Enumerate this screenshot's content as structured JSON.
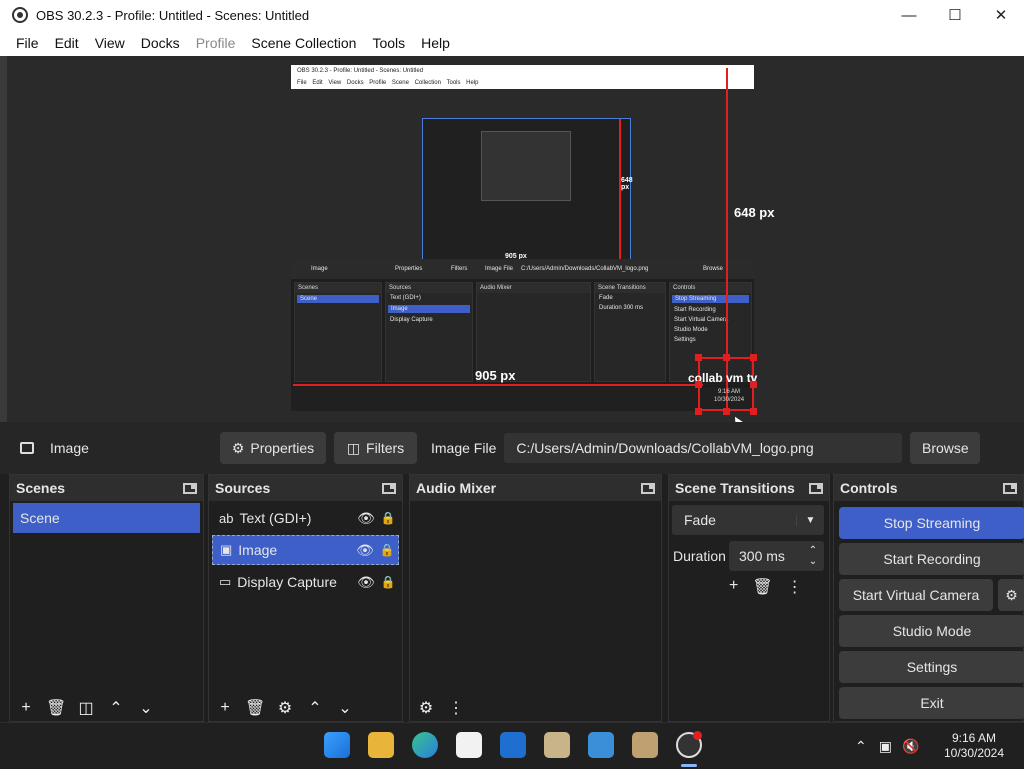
{
  "window": {
    "title": "OBS 30.2.3 - Profile: Untitled - Scenes: Untitled"
  },
  "menu": {
    "items": [
      "File",
      "Edit",
      "View",
      "Docks",
      "Profile",
      "Scene Collection",
      "Tools",
      "Help"
    ]
  },
  "preview": {
    "nested_title": "OBS 30.2.3 - Profile: Untitled - Scenes: Untitled",
    "nested_menu": "File Edit View Docks Profile Scene Collection Tools Help",
    "height_label": "648 px",
    "width_label": "905 px",
    "inner_height_label": "648 px",
    "inner_width_label": "905 px",
    "nested_source": "Image",
    "nested_properties": "Properties",
    "nested_filters": "Filters",
    "nested_image_file": "Image File",
    "nested_path": "C:/Users/Admin/Downloads/CollabVM_logo.png",
    "nested_browse": "Browse",
    "nested_scenes": "Scenes",
    "nested_scene": "Scene",
    "nested_sources": "Sources",
    "nested_src1": "Text (GDI+)",
    "nested_src2": "Image",
    "nested_src3": "Display Capture",
    "nested_mixer": "Audio Mixer",
    "nested_transitions": "Scene Transitions",
    "nested_fade": "Fade",
    "nested_duration": "Duration",
    "nested_ms": "300 ms",
    "nested_controls": "Controls",
    "nested_c1": "Stop Streaming",
    "nested_c2": "Start Recording",
    "nested_c3": "Start Virtual Camera",
    "nested_c4": "Studio Mode",
    "nested_c5": "Settings",
    "nested_logo": "collab vm tv",
    "nested_time": "9:16 AM",
    "nested_date": "10/30/2024"
  },
  "source_bar": {
    "name": "Image",
    "properties": "Properties",
    "filters": "Filters",
    "image_file_label": "Image File",
    "path": "C:/Users/Admin/Downloads/CollabVM_logo.png",
    "browse": "Browse"
  },
  "scenes": {
    "title": "Scenes",
    "items": [
      "Scene"
    ]
  },
  "sources": {
    "title": "Sources",
    "items": [
      "Text (GDI+)",
      "Image",
      "Display Capture"
    ]
  },
  "mixer": {
    "title": "Audio Mixer"
  },
  "transitions": {
    "title": "Scene Transitions",
    "type": "Fade",
    "duration_label": "Duration",
    "duration": "300 ms"
  },
  "controls": {
    "title": "Controls",
    "stop_streaming": "Stop Streaming",
    "start_recording": "Start Recording",
    "start_virtual_camera": "Start Virtual Camera",
    "studio_mode": "Studio Mode",
    "settings": "Settings",
    "exit": "Exit"
  },
  "taskbar": {
    "time": "9:16 AM",
    "date": "10/30/2024"
  },
  "colors": {
    "accent": "#3d5fc7",
    "measure": "#e02020",
    "panel": "#272727"
  }
}
